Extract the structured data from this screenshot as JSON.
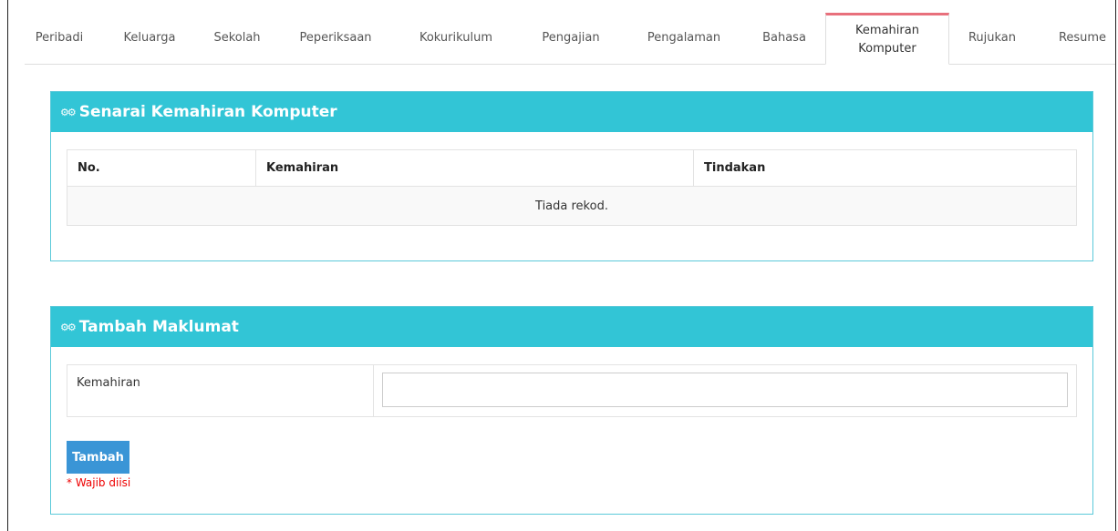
{
  "tabs": [
    {
      "label": "Peribadi",
      "active": false
    },
    {
      "label": "Keluarga",
      "active": false
    },
    {
      "label": "Sekolah",
      "active": false
    },
    {
      "label": "Peperiksaan",
      "active": false
    },
    {
      "label": "Kokurikulum",
      "active": false
    },
    {
      "label": "Pengajian",
      "active": false
    },
    {
      "label": "Pengalaman",
      "active": false
    },
    {
      "label": "Bahasa",
      "active": false
    },
    {
      "label": "Kemahiran Komputer",
      "active": true
    },
    {
      "label": "Rujukan",
      "active": false
    },
    {
      "label": "Resume",
      "active": false
    }
  ],
  "list_panel": {
    "title": "Senarai Kemahiran Komputer",
    "icon": "gears-icon",
    "columns": [
      "No.",
      "Kemahiran",
      "Tindakan"
    ],
    "empty_text": "Tiada rekod."
  },
  "form_panel": {
    "title": "Tambah Maklumat",
    "icon": "gears-icon",
    "field_label": "Kemahiran",
    "field_value": "",
    "submit_label": "Tambah",
    "required_note": "* Wajib diisi"
  },
  "colors": {
    "panel_header": "#32c5d6",
    "active_tab_accent": "#e8707c",
    "button": "#3a95d6",
    "required": "#e00000"
  }
}
